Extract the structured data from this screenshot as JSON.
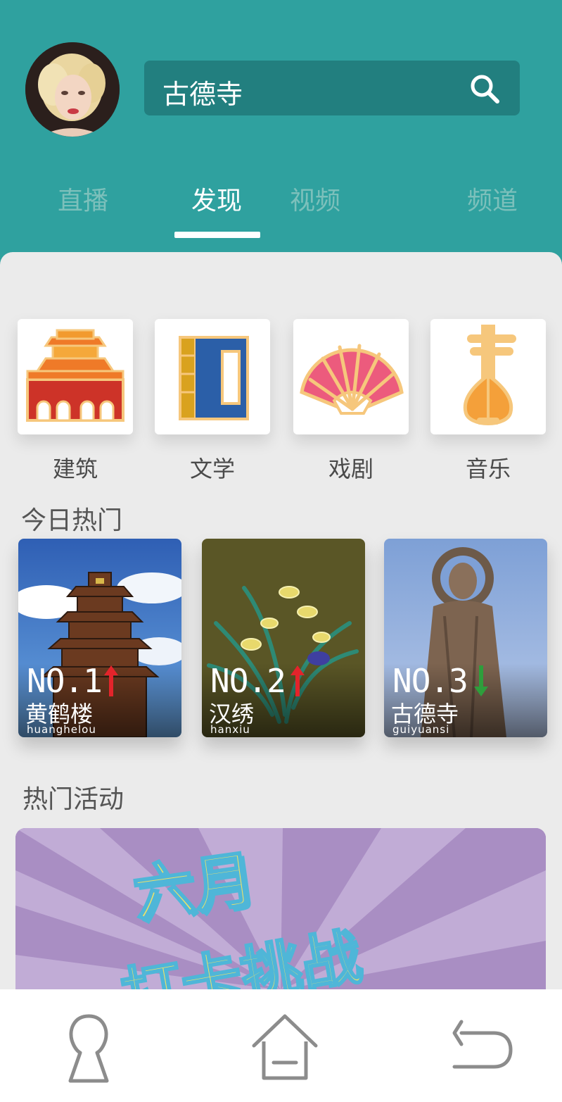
{
  "search": {
    "value": "古德寺"
  },
  "tabs": [
    {
      "label": "直播",
      "active": false
    },
    {
      "label": "发现",
      "active": true
    },
    {
      "label": "视频",
      "active": false
    },
    {
      "label": "频道",
      "active": false
    }
  ],
  "categories": [
    {
      "label": "建筑",
      "icon": "palace-icon"
    },
    {
      "label": "文学",
      "icon": "book-icon"
    },
    {
      "label": "戏剧",
      "icon": "fan-icon"
    },
    {
      "label": "音乐",
      "icon": "pipa-icon"
    }
  ],
  "today_hot": {
    "title": "今日热门",
    "items": [
      {
        "rank": "NO.1",
        "trend": "up",
        "name": "黄鹤楼",
        "pinyin": "huanghelou"
      },
      {
        "rank": "NO.2",
        "trend": "up",
        "name": "汉绣",
        "pinyin": "hanxiu"
      },
      {
        "rank": "NO.3",
        "trend": "down",
        "name": "古德寺",
        "pinyin": "guiyuansi"
      }
    ]
  },
  "activities": {
    "title": "热门活动",
    "banner_line1": "六月",
    "banner_line2": "打卡挑战"
  },
  "bottom_nav": [
    {
      "icon": "keyhole-icon"
    },
    {
      "icon": "home-icon"
    },
    {
      "icon": "back-icon"
    }
  ],
  "colors": {
    "header_bg": "#2fa19f",
    "search_bg": "#227f7f",
    "tab_inactive": "#7cc0bb",
    "content_bg": "#ebebeb",
    "trend_up": "#e3242b",
    "trend_down": "#2e9e3c",
    "banner_bg": "#a98ec3",
    "banner_text": "#ede06a"
  }
}
